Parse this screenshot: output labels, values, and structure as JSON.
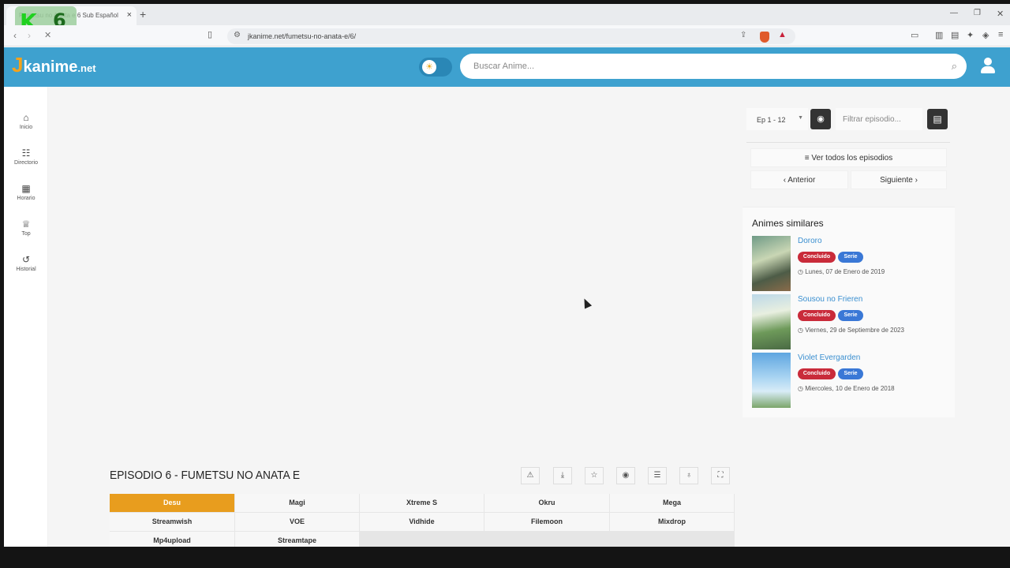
{
  "browser": {
    "tab_title": "Fumetsu no Anata e 6 Sub Español",
    "url": "jkanime.net/fumetsu-no-anata-e/6/"
  },
  "overlay": {
    "letter": "K",
    "number": "6"
  },
  "site": {
    "logo_j": "J",
    "logo_name": "kanime",
    "logo_tld": ".net",
    "search_placeholder": "Buscar Anime...",
    "accent_color": "#3ea1cf"
  },
  "sidebar": {
    "items": [
      {
        "label": "Inicio",
        "icon": "home-icon"
      },
      {
        "label": "Directorio",
        "icon": "list-icon"
      },
      {
        "label": "Horario",
        "icon": "calendar-icon"
      },
      {
        "label": "Top",
        "icon": "trophy-icon"
      },
      {
        "label": "Historial",
        "icon": "history-icon"
      }
    ]
  },
  "episode": {
    "title": "EPISODIO 6 - FUMETSU NO ANATA E",
    "tools": [
      "warning-icon",
      "download-icon",
      "star-icon",
      "eye-icon",
      "playlist-icon",
      "bulb-icon",
      "fullscreen-icon"
    ],
    "servers": [
      "Desu",
      "Magi",
      "Xtreme S",
      "Okru",
      "Mega",
      "Streamwish",
      "VOE",
      "Vidhide",
      "Filemoon",
      "Mixdrop",
      "Mp4upload",
      "Streamtape"
    ],
    "active_server": "Desu"
  },
  "episode_nav": {
    "range": "Ep 1 - 12",
    "filter_placeholder": "Filtrar episodio...",
    "view_all": "Ver todos los episodios",
    "previous": "Anterior",
    "next": "Siguiente"
  },
  "similar": {
    "heading": "Animes similares",
    "items": [
      {
        "name": "Dororo",
        "status": "Concluido",
        "type": "Serie",
        "date": "Lunes, 07 de Enero de 2019"
      },
      {
        "name": "Sousou no Frieren",
        "status": "Concluido",
        "type": "Serie",
        "date": "Viernes, 29 de Septiembre de 2023"
      },
      {
        "name": "Violet Evergarden",
        "status": "Concluido",
        "type": "Serie",
        "date": "Miercoles, 10 de Enero de 2018"
      }
    ]
  }
}
